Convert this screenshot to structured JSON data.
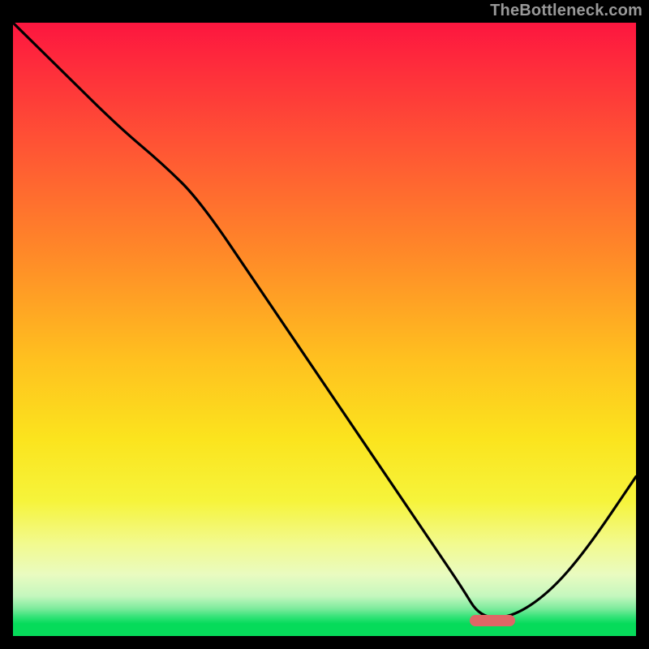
{
  "watermark": "TheBottleneck.com",
  "marker": {
    "color": "#e06666",
    "x_frac": 0.77,
    "y_frac": 0.975
  },
  "chart_data": {
    "type": "line",
    "title": "",
    "xlabel": "",
    "ylabel": "",
    "xlim": [
      0,
      1
    ],
    "ylim": [
      0,
      1
    ],
    "series": [
      {
        "name": "bottleneck-curve",
        "x": [
          0.0,
          0.08,
          0.17,
          0.24,
          0.3,
          0.4,
          0.52,
          0.62,
          0.68,
          0.72,
          0.75,
          0.8,
          0.86,
          0.92,
          1.0
        ],
        "y": [
          1.0,
          0.92,
          0.83,
          0.77,
          0.71,
          0.56,
          0.38,
          0.23,
          0.14,
          0.08,
          0.03,
          0.03,
          0.07,
          0.14,
          0.26
        ]
      }
    ],
    "annotations": [
      {
        "name": "optimal-marker",
        "x": 0.77,
        "y": 0.025,
        "shape": "rounded-bar",
        "color": "#e06666"
      }
    ],
    "background_gradient": {
      "direction": "vertical",
      "stops": [
        {
          "pos": 0.0,
          "color": "#fd163f"
        },
        {
          "pos": 0.38,
          "color": "#ff8a28"
        },
        {
          "pos": 0.68,
          "color": "#fbe41e"
        },
        {
          "pos": 0.9,
          "color": "#e9fbc0"
        },
        {
          "pos": 0.98,
          "color": "#06db5a"
        }
      ]
    }
  }
}
